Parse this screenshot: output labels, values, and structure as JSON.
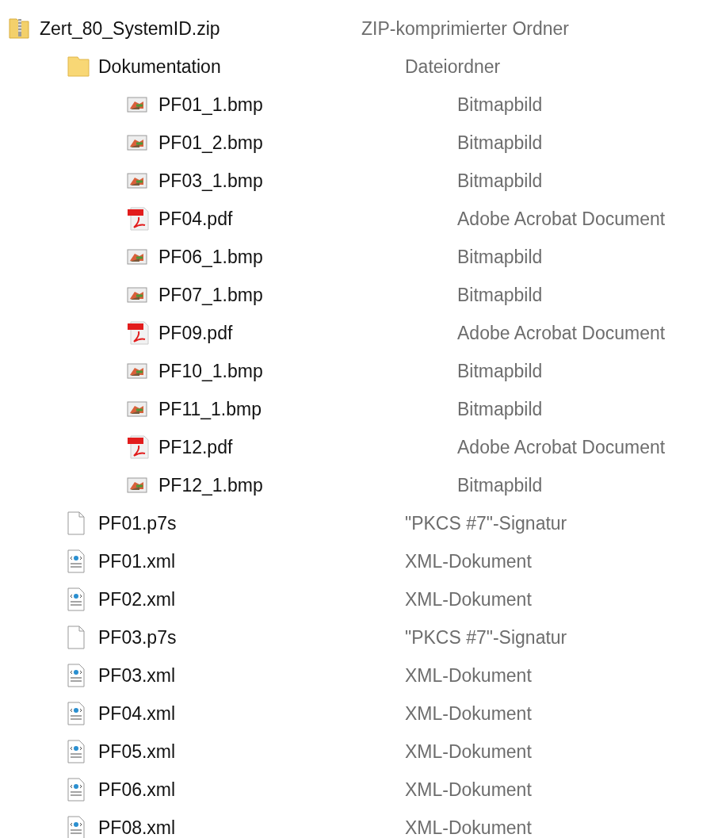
{
  "tree": [
    {
      "name": "Zert_80_SystemID.zip",
      "type": "ZIP-komprimierter Ordner",
      "kind": "zip",
      "children": [
        {
          "name": "Dokumentation",
          "type": "Dateiordner",
          "kind": "folder",
          "children": [
            {
              "name": "PF01_1.bmp",
              "type": "Bitmapbild",
              "kind": "bmp"
            },
            {
              "name": "PF01_2.bmp",
              "type": "Bitmapbild",
              "kind": "bmp"
            },
            {
              "name": "PF03_1.bmp",
              "type": "Bitmapbild",
              "kind": "bmp"
            },
            {
              "name": "PF04.pdf",
              "type": "Adobe Acrobat Document",
              "kind": "pdf"
            },
            {
              "name": "PF06_1.bmp",
              "type": "Bitmapbild",
              "kind": "bmp"
            },
            {
              "name": "PF07_1.bmp",
              "type": "Bitmapbild",
              "kind": "bmp"
            },
            {
              "name": "PF09.pdf",
              "type": "Adobe Acrobat Document",
              "kind": "pdf"
            },
            {
              "name": "PF10_1.bmp",
              "type": "Bitmapbild",
              "kind": "bmp"
            },
            {
              "name": "PF11_1.bmp",
              "type": "Bitmapbild",
              "kind": "bmp"
            },
            {
              "name": "PF12.pdf",
              "type": "Adobe Acrobat Document",
              "kind": "pdf"
            },
            {
              "name": "PF12_1.bmp",
              "type": "Bitmapbild",
              "kind": "bmp"
            }
          ]
        },
        {
          "name": "PF01.p7s",
          "type": "\"PKCS #7\"-Signatur",
          "kind": "file"
        },
        {
          "name": "PF01.xml",
          "type": "XML-Dokument",
          "kind": "xml"
        },
        {
          "name": "PF02.xml",
          "type": "XML-Dokument",
          "kind": "xml"
        },
        {
          "name": "PF03.p7s",
          "type": "\"PKCS #7\"-Signatur",
          "kind": "file"
        },
        {
          "name": "PF03.xml",
          "type": "XML-Dokument",
          "kind": "xml"
        },
        {
          "name": "PF04.xml",
          "type": "XML-Dokument",
          "kind": "xml"
        },
        {
          "name": "PF05.xml",
          "type": "XML-Dokument",
          "kind": "xml"
        },
        {
          "name": "PF06.xml",
          "type": "XML-Dokument",
          "kind": "xml"
        },
        {
          "name": "PF08.xml",
          "type": "XML-Dokument",
          "kind": "xml"
        }
      ]
    }
  ]
}
